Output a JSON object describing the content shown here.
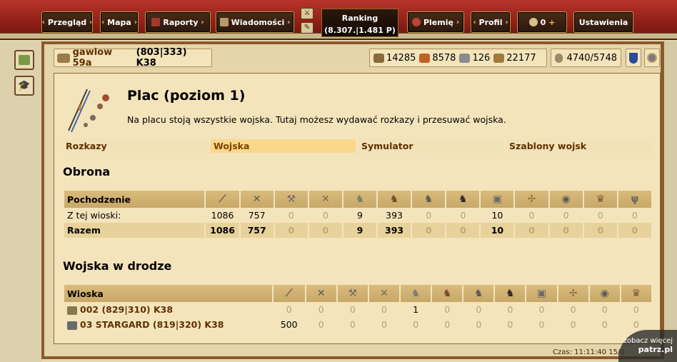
{
  "nav": {
    "przeglad": "Przegląd",
    "mapa": "Mapa",
    "raporty": "Raporty",
    "wiadomosci": "Wiadomości",
    "ranking_label": "Ranking",
    "ranking_value": "(8.307.|1.481 P)",
    "plemie": "Plemię",
    "profil": "Profil",
    "premium_count": "0",
    "premium_plus": "+",
    "ustawienia": "Ustawienia"
  },
  "village": {
    "name": "gawlow 59a",
    "coords": "(803|333) K38"
  },
  "resources": {
    "wood": "14285",
    "clay": "8578",
    "iron": "126",
    "storage": "22177",
    "population": "4740/5748"
  },
  "page": {
    "title": "Plac (poziom 1)",
    "description": "Na placu stoją wszystkie wojska. Tutaj możesz wydawać rozkazy i przesuwać wojska."
  },
  "tabs": [
    "Rozkazy",
    "Wojska",
    "Symulator",
    "Szablony wojsk"
  ],
  "defense": {
    "heading": "Obrona",
    "origin_header": "Pochodzenie",
    "rows": [
      {
        "label": "Z tej wioski:",
        "values": [
          "1086",
          "757",
          "0",
          "0",
          "9",
          "393",
          "0",
          "0",
          "10",
          "0",
          "0",
          "0",
          "0"
        ]
      },
      {
        "label": "Razem",
        "values": [
          "1086",
          "757",
          "0",
          "0",
          "9",
          "393",
          "0",
          "0",
          "10",
          "0",
          "0",
          "0",
          "0"
        ]
      }
    ]
  },
  "transit": {
    "heading": "Wojska w drodze",
    "village_header": "Wioska",
    "rows": [
      {
        "label": "002 (829|310) K38",
        "values": [
          "0",
          "0",
          "0",
          "0",
          "1",
          "0",
          "0",
          "0",
          "0",
          "0",
          "0",
          "0"
        ]
      },
      {
        "label": "03 STARGARD (819|320) K38",
        "values": [
          "500",
          "0",
          "0",
          "0",
          "0",
          "0",
          "0",
          "0",
          "0",
          "0",
          "0",
          "0"
        ]
      }
    ]
  },
  "unit_icons": [
    "spear-icon",
    "sword-icon",
    "axe-icon",
    "archer-icon",
    "spy-icon",
    "light-cavalry-icon",
    "mounted-archer-icon",
    "heavy-cavalry-icon",
    "ram-icon",
    "catapult-icon",
    "knight-icon",
    "noble-icon",
    "militia-icon"
  ],
  "footer": {
    "time": "Czas: 11:11:40 15/0"
  },
  "watermark": {
    "line1": "zobacz więcej",
    "brand": "patrz.pl"
  }
}
